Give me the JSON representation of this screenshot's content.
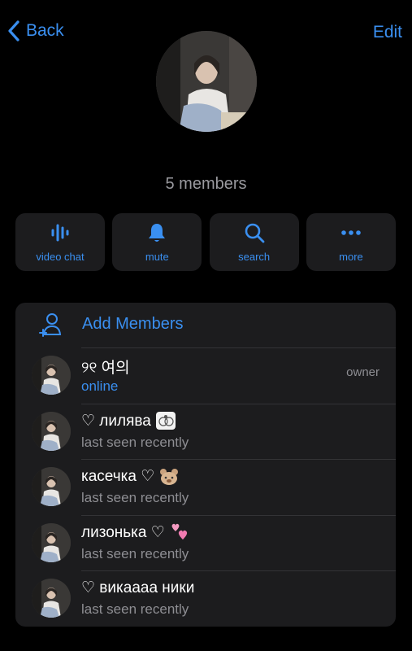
{
  "nav": {
    "back_label": "Back",
    "edit_label": "Edit"
  },
  "group": {
    "member_count": "5 members"
  },
  "actions": [
    {
      "label": "video chat",
      "icon": "voice-wave-icon"
    },
    {
      "label": "mute",
      "icon": "bell-icon"
    },
    {
      "label": "search",
      "icon": "search-icon"
    },
    {
      "label": "more",
      "icon": "more-dots-icon"
    }
  ],
  "add_members": {
    "label": "Add Members",
    "icon": "add-person-icon"
  },
  "members": [
    {
      "name": "୨୧ 여의",
      "status": "online",
      "role": "owner"
    },
    {
      "name": "♡ лилява",
      "status": "last seen recently",
      "role": ""
    },
    {
      "name": "касечка ♡",
      "status": "last seen recently",
      "role": ""
    },
    {
      "name": "лизонька ♡",
      "status": "last seen recently",
      "role": ""
    },
    {
      "name": "♡ викаааа ники",
      "status": "last seen recently",
      "role": ""
    }
  ],
  "colors": {
    "accent": "#3a8ff0",
    "background": "#000000",
    "card": "#1c1c1e",
    "secondary_text": "#8e8e93"
  }
}
